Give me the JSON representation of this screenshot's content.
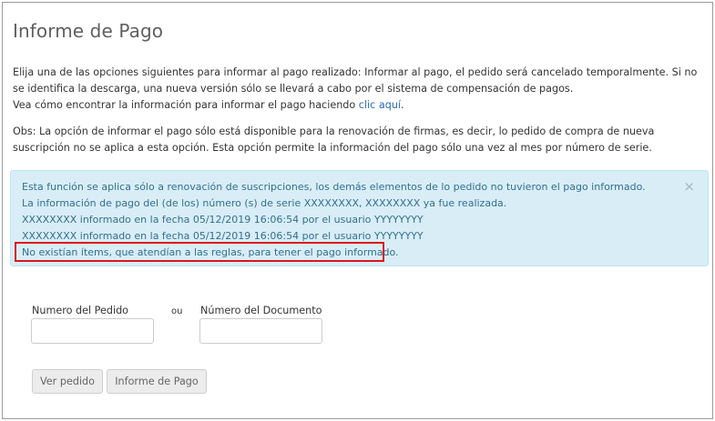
{
  "page": {
    "title": "Informe de Pago",
    "paragraph1": {
      "text": "Elija una de las opciones siguientes para informar al pago realizado: Informar al pago, el pedido será cancelado temporalmente. Si no se identifica la descarga, una nueva versión sólo se llevará a cabo por el sistema de compensación de pagos.",
      "howto_prefix": "Vea cómo encontrar la información para informar el pago haciendo ",
      "link_text": "clic aquí",
      "howto_suffix": "."
    },
    "paragraph2": "Obs: La opción de informar el pago sólo está disponible para la renovación de firmas, es decir, lo pedido de compra de nueva suscripción no se aplica a esta opción. Esta opción permite la información del pago sólo una vez al mes por número de serie."
  },
  "alert": {
    "lines": [
      "Esta función se aplica sólo a  renovación de suscripciones, los demás elementos de lo pedido no tuvieron el pago informado.",
      "La información de pago del (de los) número (s) de serie XXXXXXXX, XXXXXXXX ya fue realizada.",
      "XXXXXXXX informado en la fecha 05/12/2019 16:06:54 por el usuario YYYYYYYY",
      "XXXXXXXX informado en la fecha 05/12/2019 16:06:54 por el usuario YYYYYYYY",
      "No existían ítems, que atendían a las reglas, para tener el pago informado."
    ],
    "close_symbol": "×",
    "bg_color": "#d9edf7",
    "text_color": "#31708f",
    "highlight_color": "#d9161e"
  },
  "form": {
    "pedido_label": "Numero del Pedido",
    "ou_label": "ou",
    "documento_label": "Número del Documento",
    "pedido_value": "",
    "documento_value": ""
  },
  "buttons": {
    "ver_pedido": "Ver pedido",
    "informe_pago": "Informe de Pago"
  }
}
